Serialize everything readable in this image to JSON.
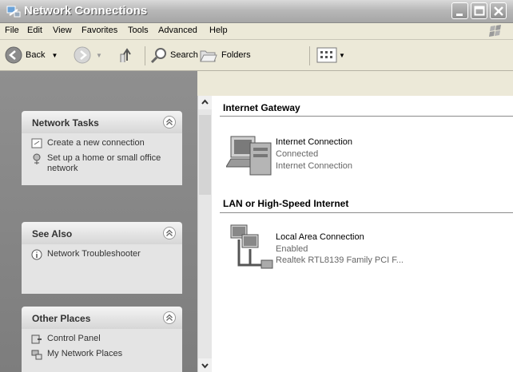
{
  "window": {
    "title": "Network Connections"
  },
  "menu": [
    "File",
    "Edit",
    "View",
    "Favorites",
    "Tools",
    "Advanced",
    "Help"
  ],
  "toolbar": {
    "back": "Back",
    "search": "Search",
    "folders": "Folders"
  },
  "network_tasks": {
    "title": "Network Tasks",
    "items": [
      "Create a new connection",
      "Set up a home or small office network"
    ]
  },
  "see_also": {
    "title": "See Also",
    "items": [
      "Network Troubleshooter"
    ]
  },
  "other_places": {
    "title": "Other Places",
    "items": [
      "Control Panel",
      "My Network Places"
    ]
  },
  "groups": [
    {
      "title": "Internet Gateway",
      "item": {
        "name": "Internet Connection",
        "status": "Connected",
        "type": "Internet Connection"
      }
    },
    {
      "title": "LAN or High-Speed Internet",
      "item": {
        "name": "Local Area Connection",
        "status": "Enabled",
        "type": "Realtek RTL8139 Family PCI F..."
      }
    }
  ]
}
